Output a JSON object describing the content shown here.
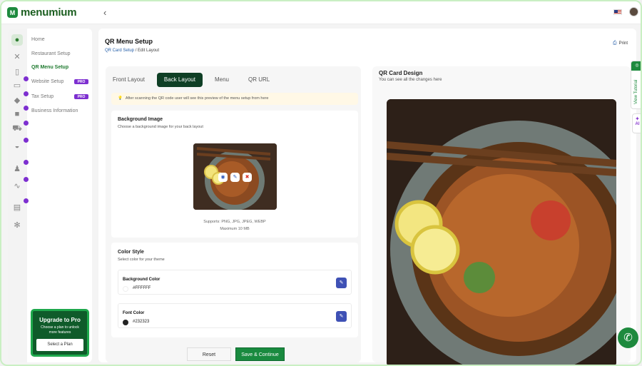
{
  "app": {
    "logo_text": "menumium",
    "logo_badge": "M"
  },
  "topbar": {
    "collapse_icon": "chevron-left-icon",
    "flag": "us-flag",
    "avatar": "user-avatar"
  },
  "sidebar": {
    "items": [
      {
        "label": "Home",
        "icon": "home-icon"
      },
      {
        "label": "Restaurant Setup",
        "icon": "restaurant-icon"
      },
      {
        "label": "QR Menu Setup",
        "icon": "qr-icon"
      },
      {
        "label": "Website Setup",
        "icon": "website-icon",
        "badge": "PRO"
      },
      {
        "label": "Tax Setup",
        "icon": "tax-icon",
        "badge": "PRO"
      },
      {
        "label": "Business Information",
        "icon": "business-icon"
      }
    ],
    "upgrade": {
      "title": "Upgrade to Pro",
      "text": "Choose a plan to unlock more features",
      "button": "Select a Plan"
    }
  },
  "header": {
    "title": "QR Menu Setup",
    "breadcrumb": {
      "link": "QR Card Setup",
      "separator": " / ",
      "current": "Edit Layout"
    },
    "print_label": "Print"
  },
  "tabs": [
    "Front Layout",
    "Back Layout",
    "Menu",
    "QR URL"
  ],
  "notice": "After scanning the QR code user will see this preview of the menu setup from here",
  "background_image": {
    "title": "Background Image",
    "subtitle": "Choose a background image for your back layout",
    "supports": "Supports: PNG, JPG, JPEG, WEBP",
    "max": "Maximum 10 MB"
  },
  "color_style": {
    "title": "Color Style",
    "subtitle": "Select color for your theme",
    "background": {
      "label": "Background Color",
      "value": "#FFFFFF"
    },
    "font": {
      "label": "Font Color",
      "value": "#232323"
    }
  },
  "buttons": {
    "reset": "Reset",
    "save": "Save & Continue"
  },
  "preview": {
    "title": "QR Card Design",
    "subtitle": "You can see all the changes here"
  },
  "floating": {
    "tutorial": "View Tutorial",
    "ai": "AI"
  },
  "colors": {
    "brand": "#1e8a3e",
    "dark_tab": "#0f3f25",
    "edit": "#3f51b5",
    "pro": "#7d2fd0"
  }
}
